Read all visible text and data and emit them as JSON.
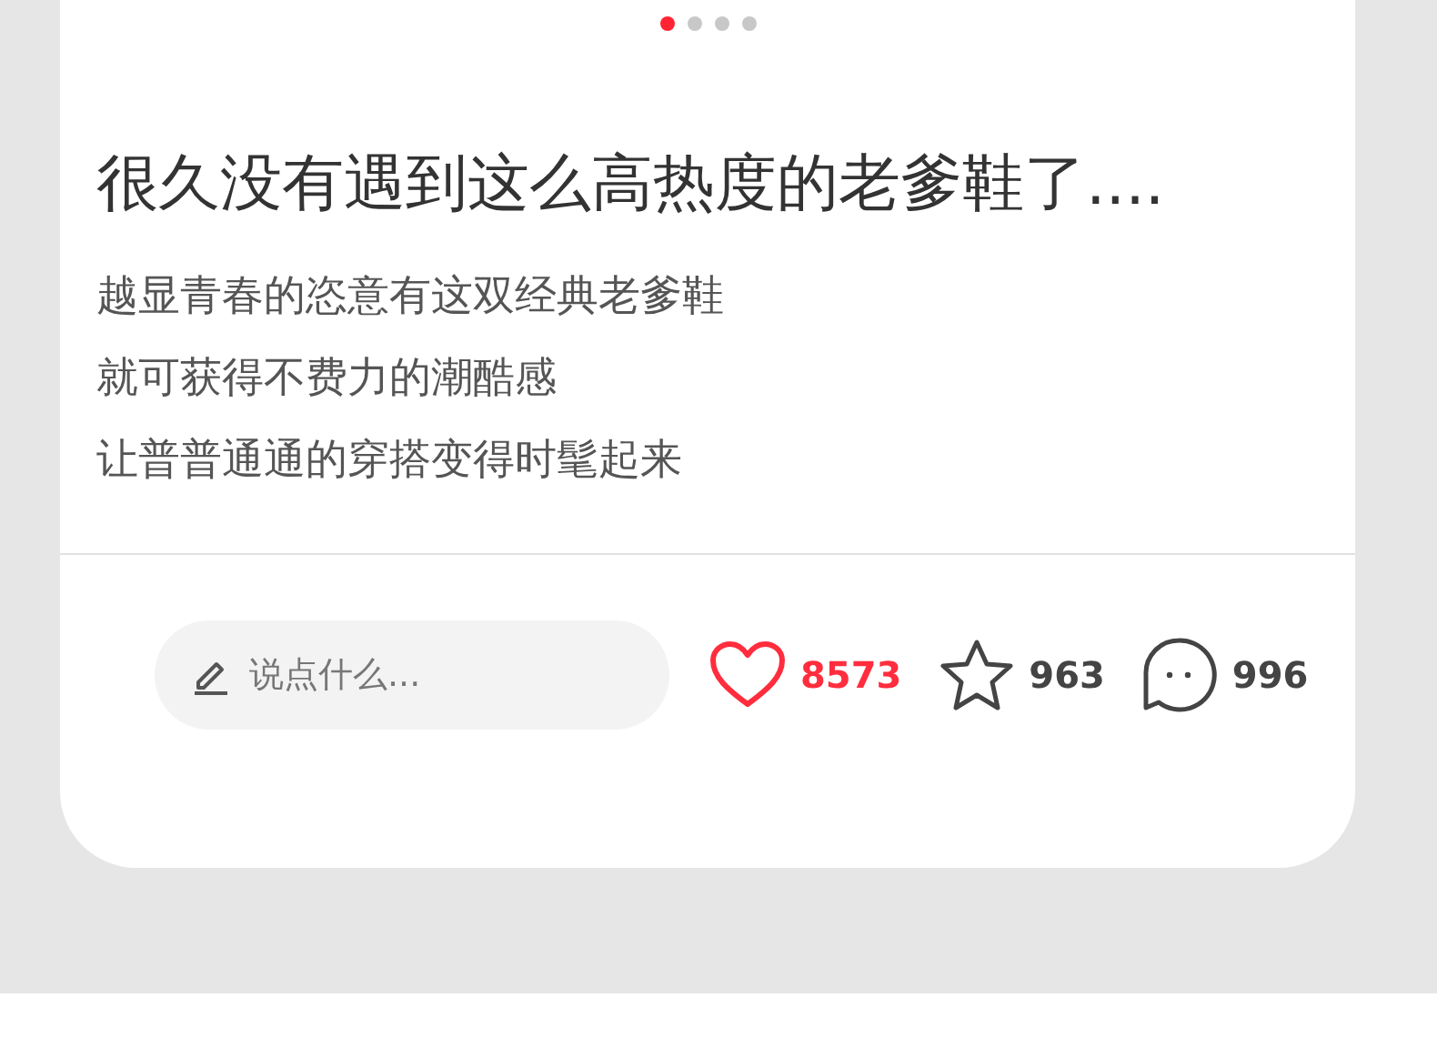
{
  "carousel": {
    "dots": [
      {
        "selected": true
      },
      {
        "selected": false
      },
      {
        "selected": false
      },
      {
        "selected": false
      }
    ]
  },
  "post": {
    "title": "很久没有遇到这么高热度的老爹鞋了....",
    "lines": [
      "越显青春的恣意有这双经典老爹鞋",
      "就可获得不费力的潮酷感",
      "让普普通通的穿搭变得时髦起来"
    ]
  },
  "actions": {
    "comment_field": {
      "placeholder": "说点什么..."
    },
    "likes": {
      "count": "8573",
      "liked": true
    },
    "favorites": {
      "count": "963",
      "favorited": false
    },
    "comments": {
      "count": "996"
    }
  }
}
